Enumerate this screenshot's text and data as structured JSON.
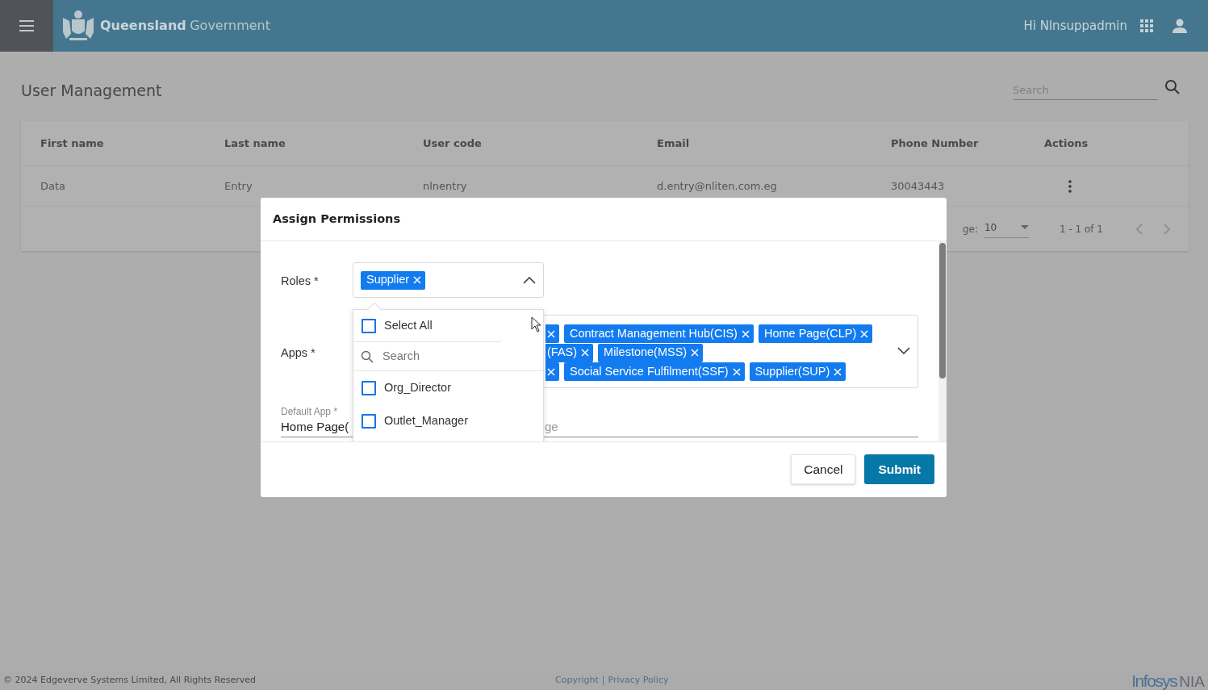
{
  "header": {
    "brand_bold": "Queensland",
    "brand_light": "Government",
    "greeting": "Hi Nlnsuppadmin"
  },
  "page": {
    "title": "User Management",
    "search": {
      "placeholder": "Search"
    }
  },
  "table": {
    "columns": [
      "First name",
      "Last name",
      "User code",
      "Email",
      "Phone Number",
      "Actions"
    ],
    "rows": [
      {
        "cells": [
          "Data",
          "Entry",
          "nlnentry",
          "d.entry@nliten.com.eg",
          "30043443"
        ]
      }
    ],
    "pagination": {
      "page_size_label": "ge:",
      "page_size": "10",
      "range": "1 - 1 of 1"
    }
  },
  "dialog": {
    "title": "Assign Permissions",
    "roles": {
      "label": "Roles *",
      "expanded": true,
      "tags": [
        {
          "label": "Supplier"
        }
      ],
      "menu": {
        "select_all": {
          "label": "Select All",
          "checked": false
        },
        "search": {
          "placeholder": "Search"
        },
        "options": [
          {
            "label": "Org_Director",
            "checked": false
          },
          {
            "label": "Outlet_Manager",
            "checked": false
          }
        ]
      }
    },
    "apps": {
      "label": "Apps *",
      "expanded": false,
      "lines": [
        [
          {
            "kind": "cut"
          },
          {
            "kind": "full",
            "label": "Contract Management Hub(CIS)"
          },
          {
            "kind": "full",
            "label": "Home Page(CLP)"
          }
        ],
        [
          {
            "kind": "cut",
            "label": "(FAS)"
          },
          {
            "kind": "full",
            "label": "Milestone(MSS)"
          }
        ],
        [
          {
            "kind": "cut"
          },
          {
            "kind": "full",
            "label": "Social Service Fulfilment(SSF)"
          },
          {
            "kind": "full",
            "label": "Supplier(SUP)"
          }
        ]
      ]
    },
    "default_app": {
      "label": "Default App *",
      "value": "Home Page(",
      "value_tail": "ge"
    },
    "buttons": [
      {
        "label": "Cancel",
        "kind": "secondary"
      },
      {
        "label": "Submit",
        "kind": "primary"
      }
    ]
  },
  "footer": {
    "copyright": "© 2024 Edgeverve Systems Limited, All Rights Reserved",
    "links": [
      "Copyright",
      "Privacy Policy"
    ],
    "separator": "|",
    "logo_main": "Infosys",
    "logo_sub": "NIA"
  }
}
